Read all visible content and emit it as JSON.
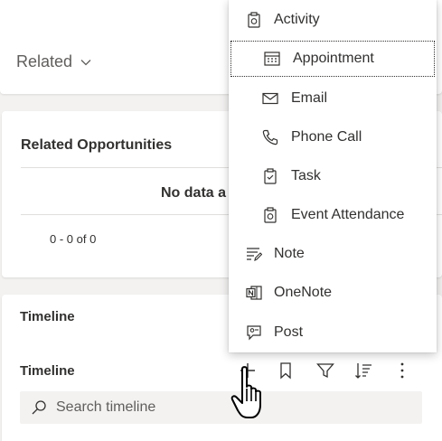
{
  "related": {
    "label": "Related"
  },
  "opportunities": {
    "title": "Related Opportunities",
    "no_data": "No data a",
    "paging": "0 - 0 of 0"
  },
  "timeline": {
    "section_title": "Timeline",
    "sub_title": "Timeline",
    "search_placeholder": "Search timeline",
    "tools": [
      "add-icon",
      "bookmark-icon",
      "filter-icon",
      "sort-icon",
      "more-icon"
    ]
  },
  "menu": {
    "items": [
      {
        "label": "Activity",
        "icon": "activity-icon",
        "level": 0
      },
      {
        "label": "Appointment",
        "icon": "calendar-icon",
        "level": 1,
        "focused": true
      },
      {
        "label": "Email",
        "icon": "mail-icon",
        "level": 1
      },
      {
        "label": "Phone Call",
        "icon": "phone-icon",
        "level": 1
      },
      {
        "label": "Task",
        "icon": "task-icon",
        "level": 1
      },
      {
        "label": "Event Attendance",
        "icon": "event-icon",
        "level": 1
      },
      {
        "label": "Note",
        "icon": "note-icon",
        "level": 0
      },
      {
        "label": "OneNote",
        "icon": "onenote-icon",
        "level": 0
      },
      {
        "label": "Post",
        "icon": "post-icon",
        "level": 0
      }
    ]
  },
  "colors": {
    "background": "#f3f2f1",
    "card": "#ffffff",
    "text": "#323130",
    "muted": "#605e5c"
  }
}
